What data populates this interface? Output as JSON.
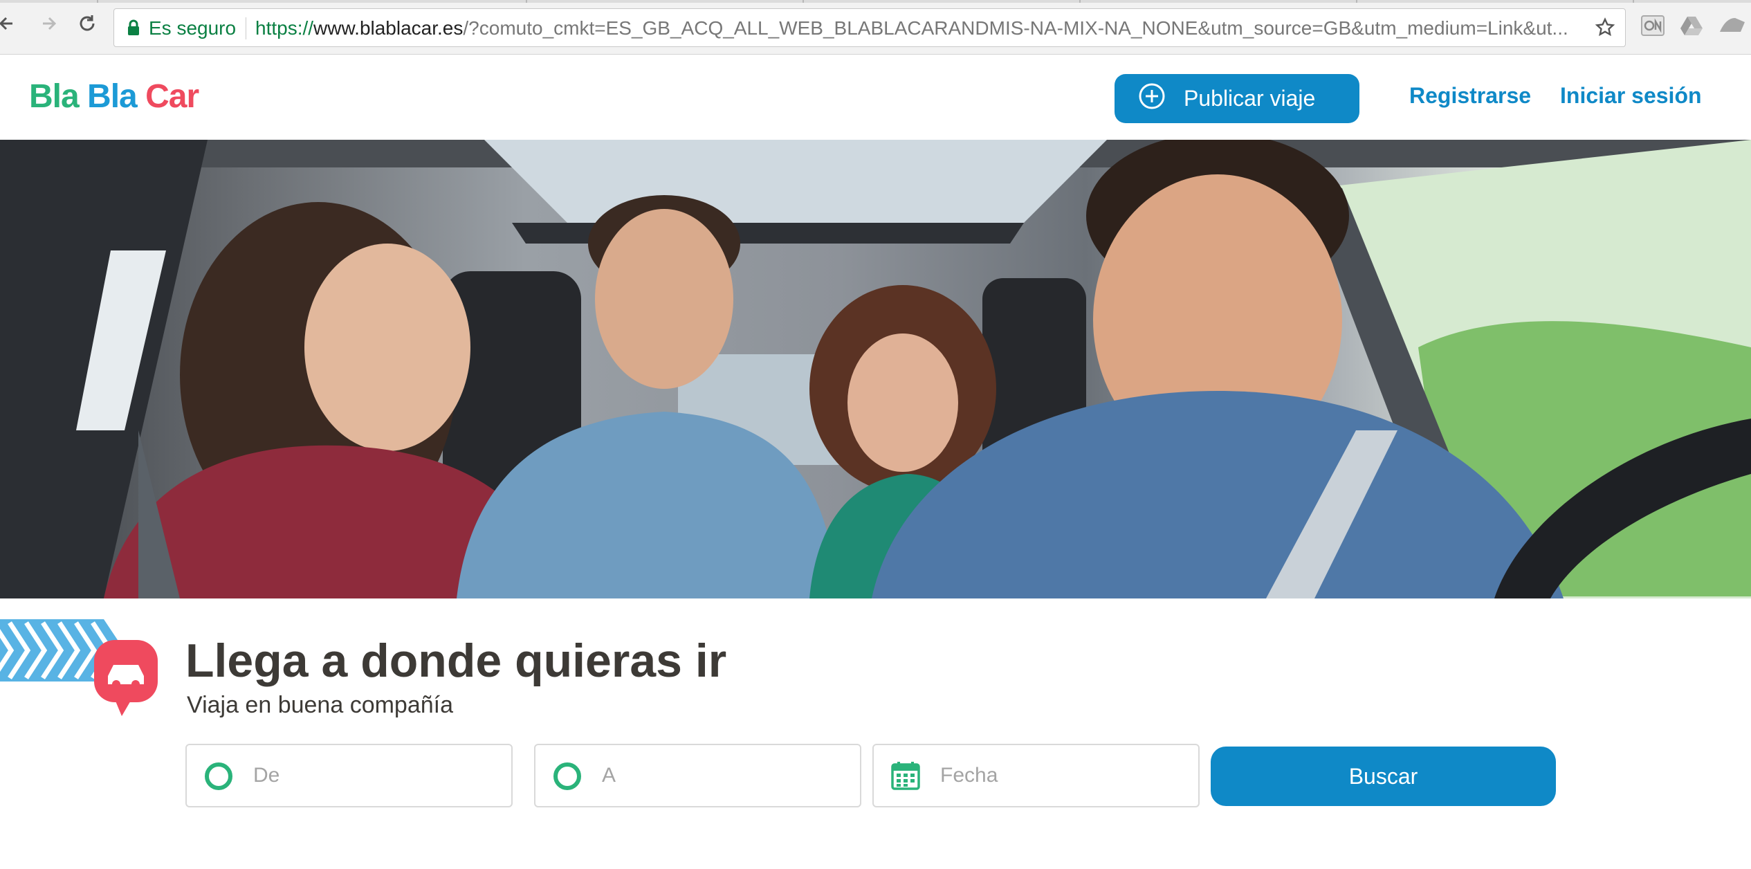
{
  "browser": {
    "security_label": "Es seguro",
    "url": {
      "scheme": "https://",
      "host": "www.blablacar.es",
      "path": "/?comuto_cmkt=ES_GB_ACQ_ALL_WEB_BLABLACARANDMIS-NA-MIX-NA_NONE&utm_source=GB&utm_medium=Link&ut..."
    }
  },
  "header": {
    "logo": {
      "part1": "Bla",
      "part2": "Bla",
      "part3": "Car"
    },
    "publish_label": "Publicar viaje",
    "register_label": "Registrarse",
    "login_label": "Iniciar sesión"
  },
  "hero": {
    "headline": "Llega a donde quieras ir",
    "subline": "Viaja en buena compañía"
  },
  "search": {
    "from_placeholder": "De",
    "to_placeholder": "A",
    "date_placeholder": "Fecha",
    "button_label": "Buscar"
  },
  "colors": {
    "brand_blue": "#0f89c7",
    "brand_green": "#2ab37a",
    "brand_red": "#ef4a5e",
    "secure_green": "#0b8043"
  }
}
